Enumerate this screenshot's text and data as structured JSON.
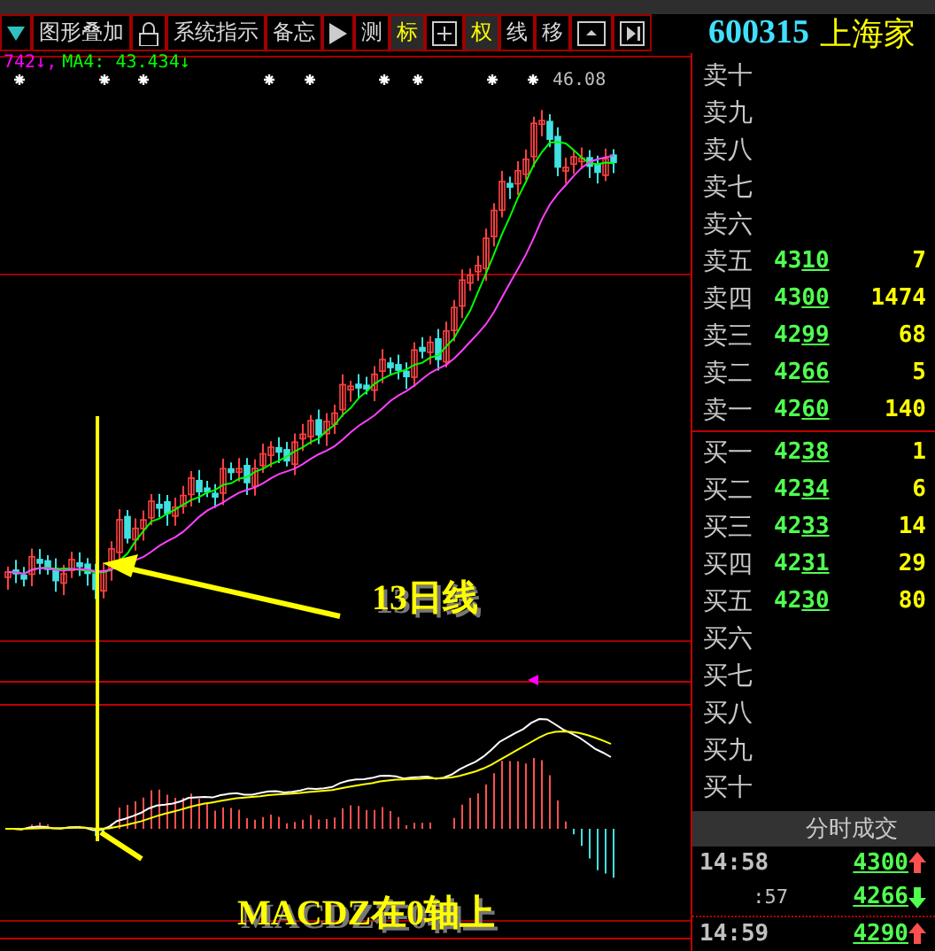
{
  "toolbar": [
    {
      "kind": "dropdown"
    },
    {
      "kind": "text",
      "label": "图形叠加",
      "selected": false
    },
    {
      "kind": "lock"
    },
    {
      "kind": "text",
      "label": "系统指示",
      "selected": false
    },
    {
      "kind": "text",
      "label": "备忘",
      "selected": false
    },
    {
      "kind": "play"
    },
    {
      "kind": "text",
      "label": "测",
      "selected": false
    },
    {
      "kind": "text",
      "label": "标",
      "selected": true
    },
    {
      "kind": "grid"
    },
    {
      "kind": "text",
      "label": "权",
      "selected": true
    },
    {
      "kind": "text",
      "label": "线",
      "selected": false
    },
    {
      "kind": "text",
      "label": "移",
      "selected": false
    },
    {
      "kind": "window"
    },
    {
      "kind": "end"
    }
  ],
  "stock": {
    "code": "600315",
    "name": "上海家"
  },
  "chart": {
    "legend": [
      {
        "text": "742↓,",
        "color": "#ff00ff"
      },
      {
        "text": "MA4: 43.434↓",
        "color": "#00ff00"
      }
    ],
    "high_label": "46.08",
    "annotations": [
      {
        "kind": "arrow",
        "text": "13日线"
      },
      {
        "kind": "leader",
        "text": "MACDZ在0轴上"
      }
    ]
  },
  "order_book": {
    "sell": [
      {
        "label": "卖十"
      },
      {
        "label": "卖九"
      },
      {
        "label": "卖八"
      },
      {
        "label": "卖七"
      },
      {
        "label": "卖六"
      },
      {
        "label": "卖五",
        "price": "4310",
        "volume": "7"
      },
      {
        "label": "卖四",
        "price": "4300",
        "volume": "1474"
      },
      {
        "label": "卖三",
        "price": "4299",
        "volume": "68"
      },
      {
        "label": "卖二",
        "price": "4266",
        "volume": "5"
      },
      {
        "label": "卖一",
        "price": "4260",
        "volume": "140"
      }
    ],
    "buy": [
      {
        "label": "买一",
        "price": "4238",
        "volume": "1"
      },
      {
        "label": "买二",
        "price": "4234",
        "volume": "6"
      },
      {
        "label": "买三",
        "price": "4233",
        "volume": "14"
      },
      {
        "label": "买四",
        "price": "4231",
        "volume": "29"
      },
      {
        "label": "买五",
        "price": "4230",
        "volume": "80"
      },
      {
        "label": "买六"
      },
      {
        "label": "买七"
      },
      {
        "label": "买八"
      },
      {
        "label": "买九"
      },
      {
        "label": "买十"
      }
    ]
  },
  "trades": {
    "title": "分时成交",
    "rows": [
      {
        "time": "14:58",
        "price": "4300",
        "rising": true,
        "separator": false
      },
      {
        "time": ":57",
        "price": "4266",
        "rising": false,
        "separator": false
      },
      {
        "time": "14:59",
        "price": "4290",
        "rising": true,
        "separator": true
      }
    ]
  }
}
